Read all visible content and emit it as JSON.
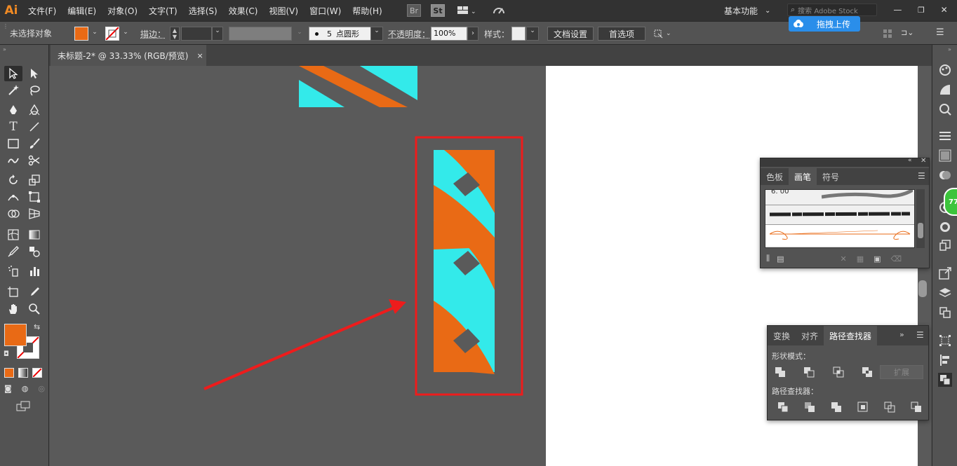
{
  "app": {
    "logo": "Ai"
  },
  "menu": [
    "文件(F)",
    "编辑(E)",
    "对象(O)",
    "文字(T)",
    "选择(S)",
    "效果(C)",
    "视图(V)",
    "窗口(W)",
    "帮助(H)"
  ],
  "menubar_right": {
    "br": "Br",
    "st": "St",
    "workspace": "基本功能",
    "search_placeholder": "搜索 Adobe Stock"
  },
  "upload_badge": {
    "label": "拖拽上传"
  },
  "controlbar": {
    "selection_status": "未选择对象",
    "stroke_label": "描边：",
    "brush_size": "5",
    "brush_name": "点圆形",
    "opacity_label": "不透明度：",
    "opacity_value": "100%",
    "style_label": "样式：",
    "doc_setup": "文档设置",
    "preferences": "首选项"
  },
  "document_tab": {
    "title": "未标题-2* @ 33.33% (RGB/预览)",
    "close": "×"
  },
  "colors": {
    "orange": "#e96a15",
    "cyan": "#33eaea",
    "highlight_red": "#ee1c1c",
    "ui_dark": "#323232",
    "ui_mid": "#535353",
    "canvas_bg": "#5a5a5a"
  },
  "brushes_panel": {
    "tabs": [
      "色板",
      "画笔",
      "符号"
    ],
    "active_tab": "画笔",
    "top_value": "6. 00"
  },
  "pathfinder_panel": {
    "tabs": [
      "变换",
      "对齐",
      "路径查找器"
    ],
    "active_tab": "路径查找器",
    "shape_modes_label": "形状模式：",
    "expand_label": "扩展",
    "pathfinders_label": "路径查找器："
  },
  "badge_green": {
    "text": "77"
  }
}
